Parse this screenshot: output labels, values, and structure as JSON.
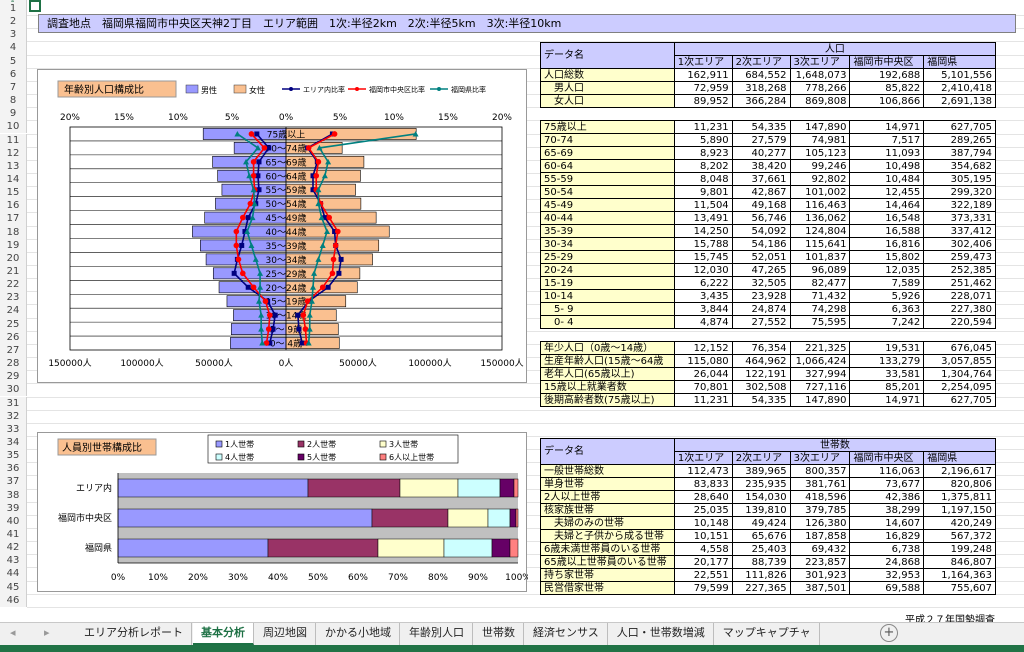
{
  "cell_ref": "1",
  "title_bar": "調査地点　福岡県福岡市中央区天神2丁目　エリア範囲　1次:半径2km　2次:半径5km　3次:半径10km",
  "row_numbers": [
    "1",
    "2",
    "3",
    "4",
    "5",
    "6",
    "7",
    "8",
    "9",
    "10",
    "11",
    "12",
    "13",
    "14",
    "15",
    "16",
    "17",
    "18",
    "19",
    "20",
    "21",
    "22",
    "23",
    "24",
    "25",
    "26",
    "27",
    "28",
    "29",
    "30",
    "31",
    "32",
    "33",
    "34",
    "35",
    "36",
    "37",
    "38",
    "39",
    "40",
    "41",
    "42",
    "43",
    "44",
    "45",
    "46"
  ],
  "pop_table": {
    "header_data_name": "データ名",
    "header_group": "人口",
    "columns": [
      "1次エリア",
      "2次エリア",
      "3次エリア",
      "福岡市中央区",
      "福岡県"
    ],
    "rows_total": [
      {
        "label": "人口総数",
        "values": [
          "162,911",
          "684,552",
          "1,648,073",
          "192,688",
          "5,101,556"
        ]
      },
      {
        "label": "　男人口",
        "values": [
          "72,959",
          "318,268",
          "778,266",
          "85,822",
          "2,410,418"
        ]
      },
      {
        "label": "　女人口",
        "values": [
          "89,952",
          "366,284",
          "869,808",
          "106,866",
          "2,691,138"
        ]
      }
    ],
    "rows_age": [
      {
        "label": "75歳以上",
        "values": [
          "11,231",
          "54,335",
          "147,890",
          "14,971",
          "627,705"
        ]
      },
      {
        "label": "70-74",
        "values": [
          "5,890",
          "27,579",
          "74,981",
          "7,517",
          "289,265"
        ]
      },
      {
        "label": "65-69",
        "values": [
          "8,923",
          "40,277",
          "105,123",
          "11,093",
          "387,794"
        ]
      },
      {
        "label": "60-64",
        "values": [
          "8,202",
          "38,420",
          "99,246",
          "10,498",
          "354,682"
        ]
      },
      {
        "label": "55-59",
        "values": [
          "8,048",
          "37,661",
          "92,802",
          "10,484",
          "305,195"
        ]
      },
      {
        "label": "50-54",
        "values": [
          "9,801",
          "42,867",
          "101,002",
          "12,455",
          "299,320"
        ]
      },
      {
        "label": "45-49",
        "values": [
          "11,504",
          "49,168",
          "116,463",
          "14,464",
          "322,189"
        ]
      },
      {
        "label": "40-44",
        "values": [
          "13,491",
          "56,746",
          "136,062",
          "16,548",
          "373,331"
        ]
      },
      {
        "label": "35-39",
        "values": [
          "14,250",
          "54,092",
          "124,804",
          "16,588",
          "337,412"
        ]
      },
      {
        "label": "30-34",
        "values": [
          "15,788",
          "54,186",
          "115,641",
          "16,816",
          "302,406"
        ]
      },
      {
        "label": "25-29",
        "values": [
          "15,745",
          "52,051",
          "101,837",
          "15,802",
          "259,473"
        ]
      },
      {
        "label": "20-24",
        "values": [
          "12,030",
          "47,265",
          "96,089",
          "12,035",
          "252,385"
        ]
      },
      {
        "label": "15-19",
        "values": [
          "6,222",
          "32,505",
          "82,477",
          "7,589",
          "251,462"
        ]
      },
      {
        "label": "10-14",
        "values": [
          "3,435",
          "23,928",
          "71,432",
          "5,926",
          "228,071"
        ]
      },
      {
        "label": "　5- 9",
        "values": [
          "3,844",
          "24,874",
          "74,298",
          "6,363",
          "227,380"
        ]
      },
      {
        "label": "　0- 4",
        "values": [
          "4,874",
          "27,552",
          "75,595",
          "7,242",
          "220,594"
        ]
      }
    ],
    "rows_summary": [
      {
        "label": "年少人口（0歳～14歳）",
        "values": [
          "12,152",
          "76,354",
          "221,325",
          "19,531",
          "676,045"
        ]
      },
      {
        "label": "生産年齢人口(15歳～64歳",
        "values": [
          "115,080",
          "464,962",
          "1,066,424",
          "133,279",
          "3,057,855"
        ]
      },
      {
        "label": "老年人口(65歳以上)",
        "values": [
          "26,044",
          "122,191",
          "327,994",
          "33,581",
          "1,304,764"
        ]
      },
      {
        "label": "15歳以上就業者数",
        "values": [
          "70,801",
          "302,508",
          "727,116",
          "85,201",
          "2,254,095"
        ]
      },
      {
        "label": "後期高齢者数(75歳以上)",
        "values": [
          "11,231",
          "54,335",
          "147,890",
          "14,971",
          "627,705"
        ]
      }
    ]
  },
  "hh_table": {
    "header_data_name": "データ名",
    "header_group": "世帯数",
    "columns": [
      "1次エリア",
      "2次エリア",
      "3次エリア",
      "福岡市中央区",
      "福岡県"
    ],
    "rows": [
      {
        "label": "一般世帯総数",
        "values": [
          "112,473",
          "389,965",
          "800,357",
          "116,063",
          "2,196,617"
        ]
      },
      {
        "label": "単身世帯",
        "values": [
          "83,833",
          "235,935",
          "381,761",
          "73,677",
          "820,806"
        ]
      },
      {
        "label": "2人以上世帯",
        "values": [
          "28,640",
          "154,030",
          "418,596",
          "42,386",
          "1,375,811"
        ]
      },
      {
        "label": "核家族世帯",
        "values": [
          "25,035",
          "139,810",
          "379,785",
          "38,299",
          "1,197,150"
        ]
      },
      {
        "label": "　夫婦のみの世帯",
        "values": [
          "10,148",
          "49,424",
          "126,380",
          "14,607",
          "420,249"
        ]
      },
      {
        "label": "　夫婦と子供から成る世帯",
        "values": [
          "10,151",
          "65,676",
          "187,858",
          "16,829",
          "567,372"
        ]
      },
      {
        "label": "6歳未満世帯員のいる世帯",
        "values": [
          "4,558",
          "25,403",
          "69,432",
          "6,738",
          "199,248"
        ]
      },
      {
        "label": "65歳以上世帯員のいる世帯",
        "values": [
          "20,177",
          "88,739",
          "223,857",
          "24,868",
          "846,807"
        ]
      },
      {
        "label": "持ち家世帯",
        "values": [
          "22,551",
          "111,826",
          "301,923",
          "32,953",
          "1,164,363"
        ]
      },
      {
        "label": "民営借家世帯",
        "values": [
          "79,599",
          "227,365",
          "387,501",
          "69,588",
          "755,607"
        ]
      }
    ]
  },
  "chart_data": [
    {
      "type": "bar",
      "title": "年齢別人口構成比",
      "legend": [
        "男性",
        "女性",
        "エリア内比率",
        "福岡市中央区比率",
        "福岡県比率"
      ],
      "categories": [
        "0～ 4歳",
        "5～ 9歳",
        "10～14歳",
        "15～19歳",
        "20～24歳",
        "25～29歳",
        "30～34歳",
        "35～39歳",
        "40～44歳",
        "45～49歳",
        "50～54歳",
        "55～59歳",
        "60～64歳",
        "65～69歳",
        "70～74歳",
        "75歳以上"
      ],
      "top_ticks": [
        "20%",
        "15%",
        "10%",
        "5%",
        "0%",
        "5%",
        "10%",
        "15%",
        "20%"
      ],
      "bottom_ticks": [
        "150000人",
        "100000人",
        "50000人",
        "0人",
        "50000人",
        "100000人",
        "150000人"
      ],
      "xlim_count": [
        -150000,
        150000
      ],
      "xlim_pct": [
        -20,
        20
      ],
      "series": [
        {
          "name": "男性",
          "values": [
            -38600,
            -38000,
            -36500,
            -41000,
            -46500,
            -50500,
            -55500,
            -59500,
            -65000,
            -56500,
            -49000,
            -44500,
            -47500,
            -51000,
            -36000,
            -57500
          ]
        },
        {
          "name": "女性",
          "values": [
            37000,
            36300,
            34900,
            41500,
            49500,
            51300,
            60100,
            64400,
            71700,
            62600,
            52000,
            48300,
            51700,
            54100,
            39000,
            90400
          ]
        },
        {
          "name": "エリア内比率",
          "values": [
            [
              -1.5,
              1.5
            ],
            [
              -1.2,
              1.2
            ],
            [
              -1.0,
              1.1
            ],
            [
              -1.7,
              2.1
            ],
            [
              -3.5,
              3.9
            ],
            [
              -4.8,
              4.9
            ],
            [
              -4.5,
              5.1
            ],
            [
              -4.1,
              4.6
            ],
            [
              -3.8,
              4.5
            ],
            [
              -3.5,
              3.6
            ],
            [
              -2.8,
              3.2
            ],
            [
              -2.5,
              2.5
            ],
            [
              -2.6,
              2.5
            ],
            [
              -2.5,
              2.9
            ],
            [
              -1.6,
              2.0
            ],
            [
              -2.7,
              4.3
            ]
          ]
        },
        {
          "name": "福岡市中央区比率",
          "values": [
            [
              -1.8,
              1.9
            ],
            [
              -1.6,
              1.8
            ],
            [
              -1.5,
              1.6
            ],
            [
              -1.9,
              2.0
            ],
            [
              -3.0,
              3.4
            ],
            [
              -4.0,
              4.3
            ],
            [
              -4.4,
              4.4
            ],
            [
              -4.6,
              4.6
            ],
            [
              -4.6,
              4.8
            ],
            [
              -4.0,
              4.0
            ],
            [
              -3.3,
              3.2
            ],
            [
              -2.9,
              2.8
            ],
            [
              -3.0,
              2.8
            ],
            [
              -3.0,
              3.0
            ],
            [
              -2.0,
              2.1
            ],
            [
              -3.2,
              4.5
            ]
          ]
        },
        {
          "name": "福岡県比率",
          "values": [
            [
              -2.2,
              2.1
            ],
            [
              -2.3,
              2.2
            ],
            [
              -2.3,
              2.2
            ],
            [
              -2.5,
              2.4
            ],
            [
              -2.4,
              2.5
            ],
            [
              -2.4,
              2.6
            ],
            [
              -2.8,
              3.0
            ],
            [
              -3.2,
              3.4
            ],
            [
              -3.6,
              3.8
            ],
            [
              -3.1,
              3.3
            ],
            [
              -2.9,
              3.0
            ],
            [
              -3.0,
              3.0
            ],
            [
              -3.4,
              3.6
            ],
            [
              -3.7,
              3.9
            ],
            [
              -2.6,
              3.1
            ],
            [
              -4.5,
              12.0
            ]
          ]
        }
      ]
    },
    {
      "type": "bar",
      "stacked": "percent",
      "title": "人員別世帯構成比",
      "legend": [
        "1人世帯",
        "2人世帯",
        "3人世帯",
        "4人世帯",
        "5人世帯",
        "6人以上世帯"
      ],
      "categories": [
        "エリア内",
        "福岡市中央区",
        "福岡県"
      ],
      "x_ticks": [
        "0%",
        "10%",
        "20%",
        "30%",
        "40%",
        "50%",
        "60%",
        "70%",
        "80%",
        "90%",
        "100%"
      ],
      "series": [
        {
          "name": "1人世帯",
          "values": [
            47.5,
            63.5,
            37.5
          ]
        },
        {
          "name": "2人世帯",
          "values": [
            23.0,
            19.0,
            27.5
          ]
        },
        {
          "name": "3人世帯",
          "values": [
            14.5,
            10.0,
            16.5
          ]
        },
        {
          "name": "4人世帯",
          "values": [
            10.5,
            5.5,
            12.0
          ]
        },
        {
          "name": "5人世帯",
          "values": [
            3.5,
            1.5,
            4.5
          ]
        },
        {
          "name": "6人以上世帯",
          "values": [
            1.0,
            0.5,
            2.0
          ]
        }
      ]
    }
  ],
  "colors": {
    "male": "#9999ff",
    "female": "#fac090",
    "area_line": "#000080",
    "ward_line": "#ff0000",
    "pref_line": "#008080",
    "hh": [
      "#9999ff",
      "#993366",
      "#ffffcc",
      "#ccffff",
      "#660066",
      "#ff8080"
    ],
    "header": "#ccccff",
    "label": "#ffffcc",
    "excel_green": "#217346"
  },
  "tabs": [
    "エリア分析レポート",
    "基本分析",
    "周辺地図",
    "かかる小地域",
    "年齢別人口",
    "世帯数",
    "経済センサス",
    "人口・世帯数増減",
    "マップキャプチャ"
  ],
  "active_tab": "基本分析",
  "footer_note": "平成２７年国勢調査"
}
